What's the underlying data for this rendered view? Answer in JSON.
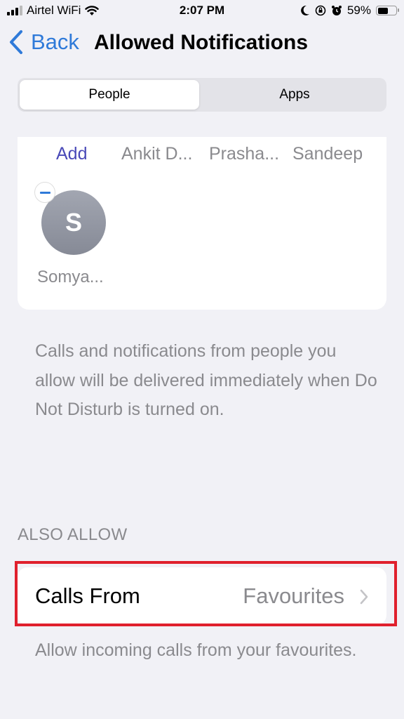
{
  "status_bar": {
    "carrier": "Airtel WiFi",
    "time": "2:07 PM",
    "battery": "59%",
    "battery_level": 0.59,
    "icons": [
      "signal-icon",
      "wifi-icon",
      "moon-icon",
      "orientation-lock-icon",
      "alarm-icon",
      "battery-icon"
    ]
  },
  "nav": {
    "back_label": "Back",
    "title": "Allowed Notifications"
  },
  "segmented": {
    "options": [
      "People",
      "Apps"
    ],
    "selected": "People"
  },
  "people": {
    "add_label": "Add",
    "top_row": [
      "Ankit D...",
      "Prasha...",
      "Sandeep"
    ],
    "contacts": [
      {
        "initial": "S",
        "name": "Somya..."
      }
    ]
  },
  "people_footnote": "Calls and notifications from people you allow will be delivered immediately when Do Not Disturb is turned on.",
  "also_allow": {
    "header": "ALSO ALLOW",
    "calls_from_label": "Calls From",
    "calls_from_value": "Favourites",
    "footnote": "Allow incoming calls from your favourites."
  },
  "colors": {
    "accent": "#2f7ad9",
    "add_link": "#4a4ab8",
    "highlight": "#e0202d",
    "background": "#f1f1f6"
  }
}
